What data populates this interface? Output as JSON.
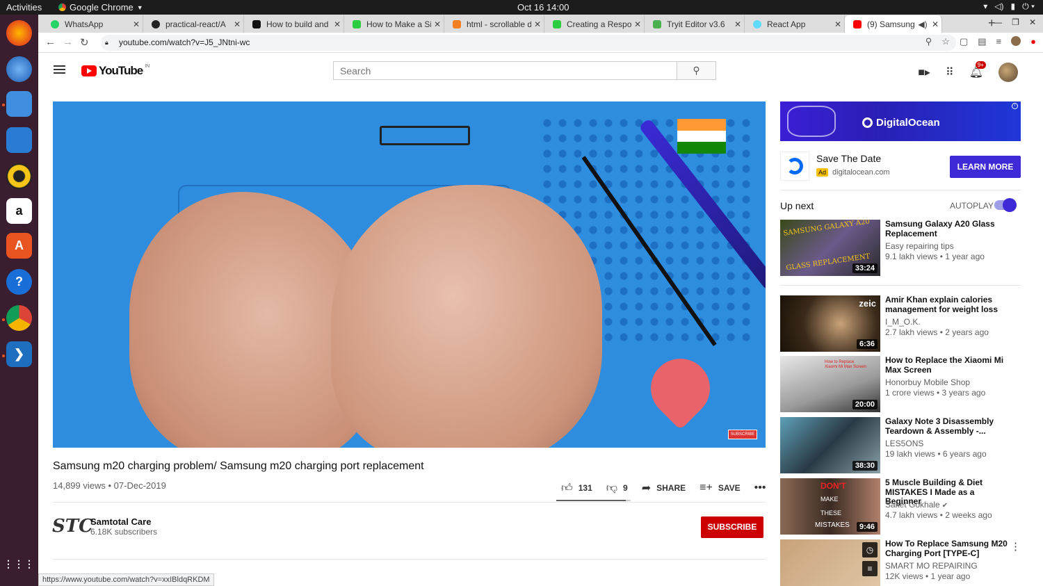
{
  "system": {
    "activities": "Activities",
    "app_name": "Google Chrome",
    "clock": "Oct 16  14:00"
  },
  "tabs": [
    {
      "label": "WhatsApp",
      "fav": "#25d366"
    },
    {
      "label": "practical-react/A",
      "fav": "#222222"
    },
    {
      "label": "How to build and",
      "fav": "#111111"
    },
    {
      "label": "How to Make a Si",
      "fav": "#2ecc40"
    },
    {
      "label": "html - scrollable d",
      "fav": "#f48024"
    },
    {
      "label": "Creating a Respo",
      "fav": "#2ecc40"
    },
    {
      "label": "Tryit Editor v3.6",
      "fav": "#4caf50"
    },
    {
      "label": "React App",
      "fav": "#61dafb"
    },
    {
      "label": "(9) Samsung m",
      "fav": "#ff0000"
    }
  ],
  "omnibox": {
    "url": "youtube.com/watch?v=J5_JNtni-wc"
  },
  "youtube": {
    "logo_text": "YouTube",
    "logo_region": "IN",
    "search_placeholder": "Search",
    "notif_count": "9+"
  },
  "video": {
    "title": "Samsung m20 charging problem/ Samsung m20 charging port replacement",
    "views": "14,899 views",
    "date": "07-Dec-2019",
    "likes": "131",
    "dislikes": "9",
    "like_ratio": 0.936,
    "share_label": "SHARE",
    "save_label": "SAVE",
    "overlay_badge": "SUBSCRIBE"
  },
  "channel": {
    "logo": "STC",
    "name": "Samtotal Care",
    "subscribers": "6.18K subscribers",
    "subscribe_label": "SUBSCRIBE"
  },
  "ad": {
    "brand": "DigitalOcean",
    "title": "Save The Date",
    "tag": "Ad",
    "domain": "digitalocean.com",
    "cta": "LEARN MORE"
  },
  "sidebar": {
    "up_next": "Up next",
    "autoplay": "AUTOPLAY",
    "autoplay_on": true,
    "recommendations": [
      {
        "title": "Samsung Galaxy A20 Glass Replacement",
        "channel": "Easy repairing tips",
        "stats": "9.1 lakh views • 1 year ago",
        "duration": "33:24",
        "thumb_text": "SAMSUNG GALAXY A20",
        "thumb_text2": "GLASS REPLACEMENT"
      },
      {
        "title": "Amir Khan explain calories management for weight loss",
        "channel": "I_M_O.K.",
        "stats": "2.7 lakh views • 2 years ago",
        "duration": "6:36",
        "thumb_text": "zeic"
      },
      {
        "title": "How to Replace the Xiaomi Mi Max Screen",
        "channel": "Honorbuy Mobile Shop",
        "stats": "1 crore views • 3 years ago",
        "duration": "20:00",
        "thumb_text": "How to Replace",
        "thumb_text2": "Xiaomi Mi Max Screen"
      },
      {
        "title": "Galaxy Note 3 Disassembly Teardown & Assembly -...",
        "channel": "LES5ONS",
        "stats": "19 lakh views • 6 years ago",
        "duration": "38:30"
      },
      {
        "title": "5 Muscle Building & Diet MISTAKES I Made as a Beginner",
        "channel": "Saket Gokhale",
        "stats": "4.7 lakh views • 2 weeks ago",
        "duration": "9:46",
        "thumb_text": "DON'T",
        "thumb_text2": "MAKE",
        "thumb_text3": "THESE",
        "thumb_text4": "MISTAKES"
      },
      {
        "title": "How To Replace Samsung M20 Charging Port [TYPE-C]",
        "channel": "SMART MO REPAIRING",
        "stats": "12K views • 1 year ago"
      }
    ]
  },
  "status_url": "https://www.youtube.com/watch?v=xxIBldqRKDM"
}
